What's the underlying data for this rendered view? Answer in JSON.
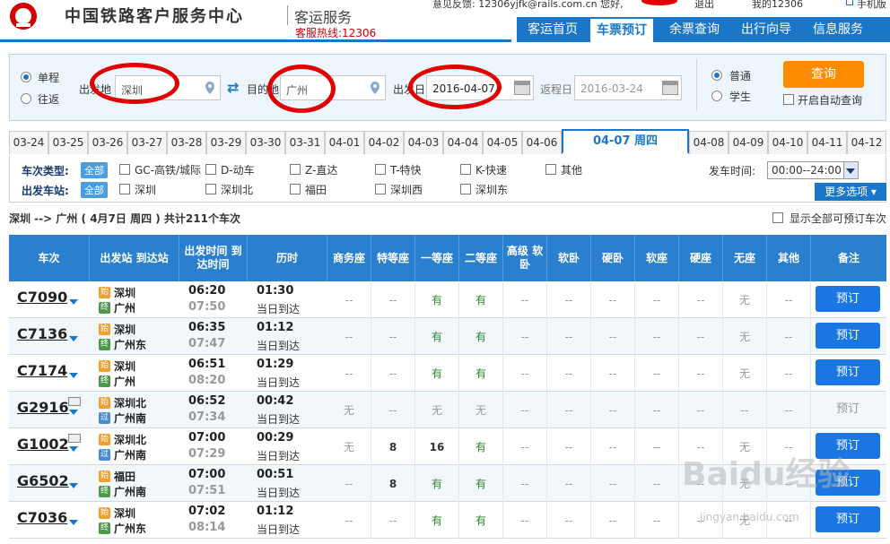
{
  "header": {
    "topbar_text": "意见反馈: 12306yjfk@rails.com.cn  您好,",
    "topbar_logout": "退出",
    "topbar_my": "我的12306",
    "topbar_mobile": "手机版",
    "site_title": "中国铁路客户服务中心",
    "sub_title": "客运服务",
    "hotline": "客服热线:12306"
  },
  "nav": [
    {
      "label": "客运首页"
    },
    {
      "label": "车票预订"
    },
    {
      "label": "余票查询"
    },
    {
      "label": "出行向导"
    },
    {
      "label": "信息服务"
    }
  ],
  "search": {
    "trip_one_way": "单程",
    "trip_round": "往返",
    "from_label": "出发地",
    "from_value": "深圳",
    "to_label": "目的地",
    "to_value": "广州",
    "date_label": "出发日",
    "date_value": "2016-04-07",
    "return_label": "返程日",
    "return_value": "2016-03-24",
    "type_normal": "普通",
    "type_student": "学生",
    "query_label": "查询",
    "auto_query_label": "开启自动查询"
  },
  "date_tabs": [
    "03-24",
    "03-25",
    "03-26",
    "03-27",
    "03-28",
    "03-29",
    "03-30",
    "03-31",
    "04-01",
    "04-02",
    "04-03",
    "04-04",
    "04-05",
    "04-06",
    "04-07 周四",
    "04-08",
    "04-09",
    "04-10",
    "04-11",
    "04-12"
  ],
  "filters": {
    "train_type_title": "车次类型:",
    "all_label": "全部",
    "train_types": [
      "GC-高铁/城际",
      "D-动车",
      "Z-直达",
      "T-特快",
      "K-快速",
      "其他"
    ],
    "station_title": "出发车站:",
    "stations": [
      "深圳",
      "深圳北",
      "福田",
      "深圳西",
      "深圳东"
    ],
    "depart_time_label": "发车时间:",
    "depart_time_value": "00:00--24:00",
    "more_label": "更多选项"
  },
  "summary": {
    "text": "深圳 --> 广州 ( 4月7日  周四 ) 共计211个车次",
    "show_all": "显示全部可预订车次"
  },
  "columns": [
    "车次",
    "出发站 到达站",
    "出发时间 到达时间",
    "历时",
    "商务座",
    "特等座",
    "一等座",
    "二等座",
    "高级 软卧",
    "软卧",
    "硬卧",
    "软座",
    "硬座",
    "无座",
    "其他",
    "备注"
  ],
  "trains": [
    {
      "no": "C7090",
      "id": false,
      "from": "深圳",
      "from_type": "始",
      "to": "广州",
      "to_type": "终",
      "dep": "06:20",
      "arr": "07:50",
      "dur": "01:30",
      "note": "当日到达",
      "seats": [
        "--",
        "--",
        "有",
        "有",
        "--",
        "--",
        "--",
        "--",
        "--",
        "无",
        "--"
      ],
      "book": "预订",
      "bookable": true
    },
    {
      "no": "C7136",
      "id": false,
      "from": "深圳",
      "from_type": "始",
      "to": "广州东",
      "to_type": "终",
      "dep": "06:35",
      "arr": "07:47",
      "dur": "01:12",
      "note": "当日到达",
      "seats": [
        "--",
        "--",
        "有",
        "有",
        "--",
        "--",
        "--",
        "--",
        "--",
        "无",
        "--"
      ],
      "book": "预订",
      "bookable": true
    },
    {
      "no": "C7174",
      "id": false,
      "from": "深圳",
      "from_type": "始",
      "to": "广州",
      "to_type": "终",
      "dep": "06:51",
      "arr": "08:20",
      "dur": "01:29",
      "note": "当日到达",
      "seats": [
        "--",
        "--",
        "有",
        "有",
        "--",
        "--",
        "--",
        "--",
        "--",
        "无",
        "--"
      ],
      "book": "预订",
      "bookable": true
    },
    {
      "no": "G2916",
      "id": true,
      "from": "深圳北",
      "from_type": "始",
      "to": "广州南",
      "to_type": "过",
      "dep": "06:52",
      "arr": "07:34",
      "dur": "00:42",
      "note": "当日到达",
      "seats": [
        "无",
        "--",
        "无",
        "无",
        "--",
        "--",
        "--",
        "--",
        "--",
        "--",
        "--"
      ],
      "book": "预订",
      "bookable": false
    },
    {
      "no": "G1002",
      "id": true,
      "from": "深圳北",
      "from_type": "始",
      "to": "广州南",
      "to_type": "过",
      "dep": "07:00",
      "arr": "07:29",
      "dur": "00:29",
      "note": "当日到达",
      "seats": [
        "无",
        "8",
        "16",
        "有",
        "--",
        "--",
        "--",
        "--",
        "--",
        "无",
        "--"
      ],
      "book": "预订",
      "bookable": true
    },
    {
      "no": "G6502",
      "id": false,
      "from": "福田",
      "from_type": "始",
      "to": "广州南",
      "to_type": "终",
      "dep": "07:00",
      "arr": "07:51",
      "dur": "00:51",
      "note": "当日到达",
      "seats": [
        "--",
        "8",
        "有",
        "有",
        "--",
        "--",
        "--",
        "--",
        "--",
        "无",
        "--"
      ],
      "book": "预订",
      "bookable": true
    },
    {
      "no": "C7036",
      "id": false,
      "from": "深圳",
      "from_type": "始",
      "to": "广州东",
      "to_type": "终",
      "dep": "07:02",
      "arr": "08:14",
      "dur": "01:12",
      "note": "当日到达",
      "seats": [
        "--",
        "--",
        "有",
        "有",
        "--",
        "--",
        "--",
        "--",
        "--",
        "无",
        "--"
      ],
      "book": "预订",
      "bookable": true
    }
  ],
  "watermark": "Baidu经验",
  "watermark_url": "jingyan.baidu.com",
  "colors": {
    "brand": "#1a76c9",
    "accent": "#ff8c00",
    "red": "#d40000",
    "green": "#2a8a2a"
  }
}
